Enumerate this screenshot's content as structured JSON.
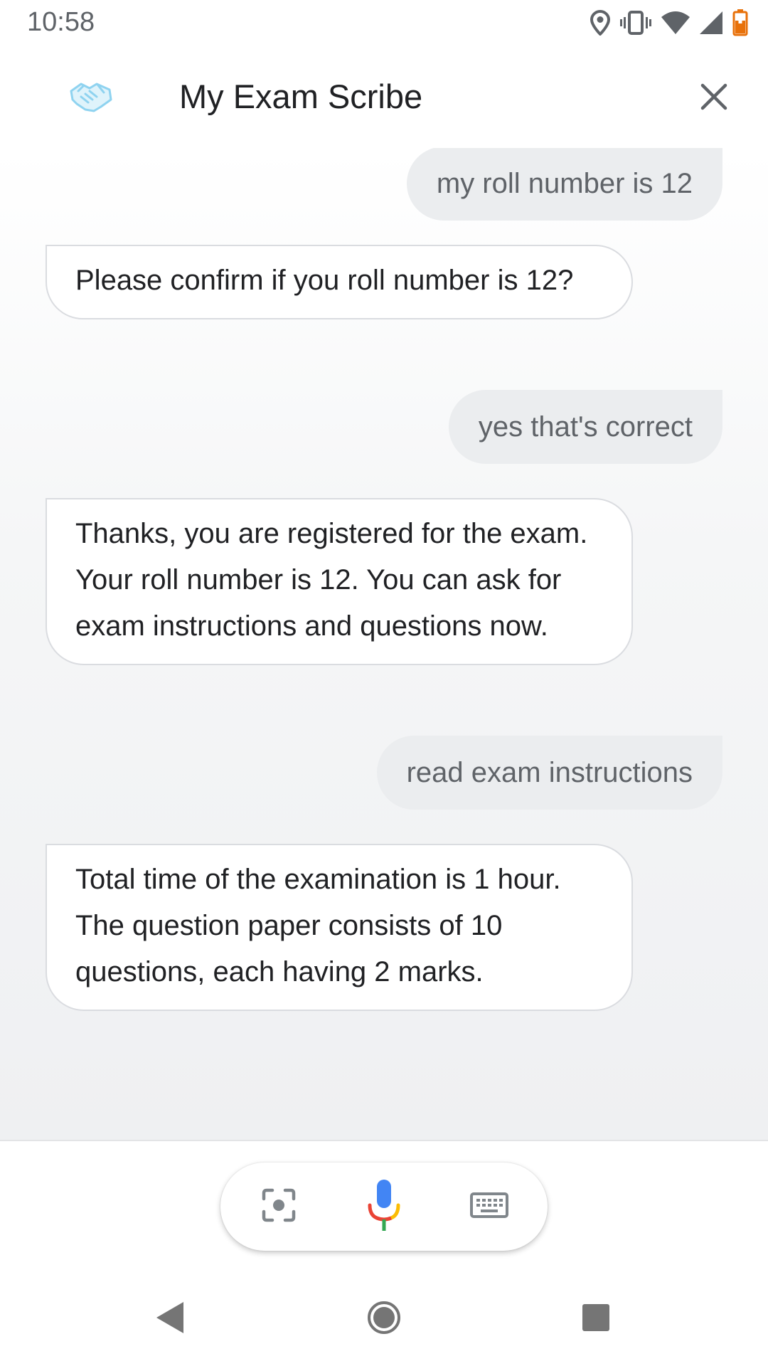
{
  "status_bar": {
    "time": "10:58"
  },
  "header": {
    "title": "My Exam Scribe"
  },
  "conversation": [
    {
      "role": "user",
      "text": "my roll number is 12"
    },
    {
      "role": "bot",
      "text": "Please confirm if you roll number is 12?"
    },
    {
      "role": "user",
      "text": "yes that's correct"
    },
    {
      "role": "bot",
      "text": "Thanks, you are registered for the exam. Your roll number is 12. You can ask for exam instructions and questions now."
    },
    {
      "role": "user",
      "text": "read exam instructions"
    },
    {
      "role": "bot",
      "text": "Total time of the examination is 1 hour. The question paper consists of 10 questions, each having 2 marks."
    }
  ],
  "icons": {
    "status": [
      "location-icon",
      "vibrate-icon",
      "wifi-icon",
      "signal-icon",
      "battery-low-icon"
    ],
    "header": [
      "handshake-logo-icon",
      "close-icon"
    ],
    "input": [
      "lens-icon",
      "mic-icon",
      "keyboard-icon"
    ],
    "nav": [
      "back-icon",
      "home-icon",
      "recents-icon"
    ]
  },
  "colors": {
    "mic_blue": "#4285F4",
    "mic_red": "#EA4335",
    "mic_yellow": "#FBBC04",
    "mic_green": "#34A853",
    "battery_orange": "#E8710A",
    "logo_blue": "#8FD3F0"
  }
}
